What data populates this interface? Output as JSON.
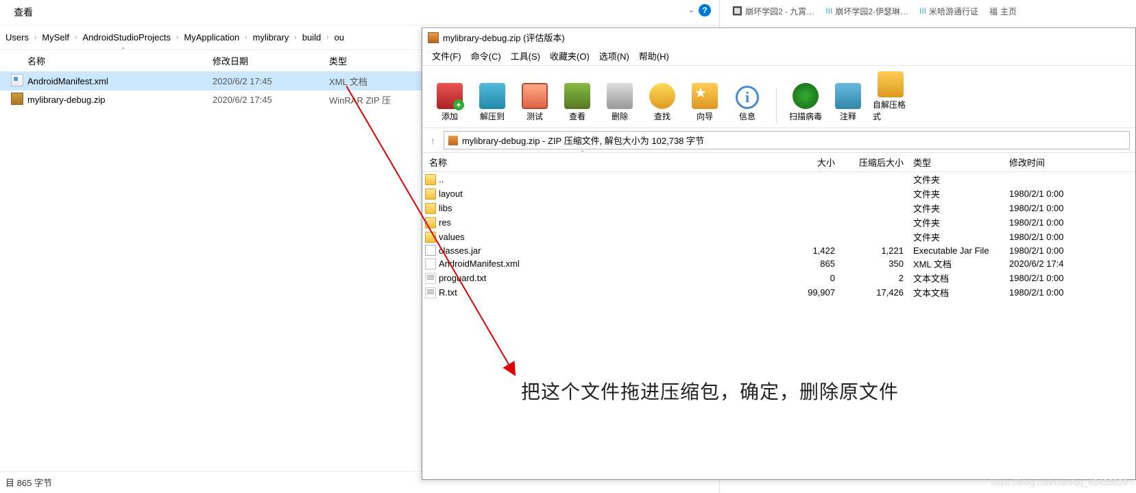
{
  "browser_tabs": [
    "崩坏学园2 - 九霄…",
    "崩坏学园2-伊瑟琳…",
    "米哈游通行证",
    "主页"
  ],
  "explorer": {
    "view_label": "查看",
    "breadcrumb": [
      "Users",
      "MySelf",
      "AndroidStudioProjects",
      "MyApplication",
      "mylibrary",
      "build",
      "ou"
    ],
    "columns": {
      "name": "名称",
      "date": "修改日期",
      "type": "类型"
    },
    "rows": [
      {
        "name": "AndroidManifest.xml",
        "date": "2020/6/2 17:45",
        "type": "XML 文档",
        "icon": "icon-xml",
        "selected": true
      },
      {
        "name": "mylibrary-debug.zip",
        "date": "2020/6/2 17:45",
        "type": "WinRAR ZIP 压",
        "icon": "icon-zip",
        "selected": false
      }
    ],
    "status": "目  865 字节"
  },
  "winrar": {
    "title": "mylibrary-debug.zip (评估版本)",
    "menus": [
      "文件(F)",
      "命令(C)",
      "工具(S)",
      "收藏夹(O)",
      "选项(N)",
      "帮助(H)"
    ],
    "toolbar": [
      {
        "label": "添加",
        "cls": "tb-add"
      },
      {
        "label": "解压到",
        "cls": "tb-extract"
      },
      {
        "label": "测试",
        "cls": "tb-test"
      },
      {
        "label": "查看",
        "cls": "tb-view"
      },
      {
        "label": "删除",
        "cls": "tb-delete"
      },
      {
        "label": "查找",
        "cls": "tb-find"
      },
      {
        "label": "向导",
        "cls": "tb-wizard"
      },
      {
        "label": "信息",
        "cls": "tb-info"
      }
    ],
    "toolbar2": [
      {
        "label": "扫描病毒",
        "cls": "tb-virus"
      },
      {
        "label": "注释",
        "cls": "tb-comment"
      },
      {
        "label": "自解压格式",
        "cls": "tb-sfx"
      }
    ],
    "address": "mylibrary-debug.zip - ZIP 压缩文件, 解包大小为 102,738 字节",
    "columns": {
      "name": "名称",
      "size": "大小",
      "packed": "压缩后大小",
      "type": "类型",
      "date": "修改时间"
    },
    "rows": [
      {
        "name": "..",
        "size": "",
        "packed": "",
        "type": "文件夹",
        "date": "",
        "icon": "ic-folder"
      },
      {
        "name": "layout",
        "size": "",
        "packed": "",
        "type": "文件夹",
        "date": "1980/2/1 0:00",
        "icon": "ic-folder"
      },
      {
        "name": "libs",
        "size": "",
        "packed": "",
        "type": "文件夹",
        "date": "1980/2/1 0:00",
        "icon": "ic-folder"
      },
      {
        "name": "res",
        "size": "",
        "packed": "",
        "type": "文件夹",
        "date": "1980/2/1 0:00",
        "icon": "ic-folder"
      },
      {
        "name": "values",
        "size": "",
        "packed": "",
        "type": "文件夹",
        "date": "1980/2/1 0:00",
        "icon": "ic-folder"
      },
      {
        "name": "classes.jar",
        "size": "1,422",
        "packed": "1,221",
        "type": "Executable Jar File",
        "date": "1980/2/1 0:00",
        "icon": "ic-jar"
      },
      {
        "name": "AndroidManifest.xml",
        "size": "865",
        "packed": "350",
        "type": "XML 文档",
        "date": "2020/6/2 17:4",
        "icon": "ic-xml"
      },
      {
        "name": "proguard.txt",
        "size": "0",
        "packed": "2",
        "type": "文本文档",
        "date": "1980/2/1 0:00",
        "icon": "ic-txt"
      },
      {
        "name": "R.txt",
        "size": "99,907",
        "packed": "17,426",
        "type": "文本文档",
        "date": "1980/2/1 0:00",
        "icon": "ic-txt"
      }
    ]
  },
  "annotation": "把这个文件拖进压缩包，确定，删除原文件",
  "watermark": "https://blog.csdn.net/qq_42438039"
}
